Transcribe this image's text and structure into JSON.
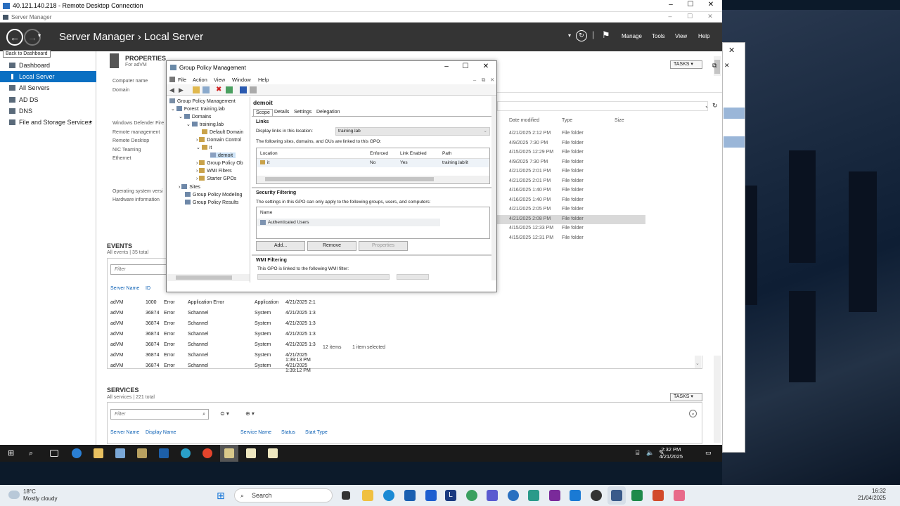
{
  "rdp": {
    "title": "40.121.140.218 - Remote Desktop Connection",
    "minimize": "–",
    "maximize": "☐",
    "close": "✕"
  },
  "server_manager": {
    "title": "Server Manager",
    "breadcrumb": "Server Manager  ›  Local Server",
    "menu": {
      "manage": "Manage",
      "tools": "Tools",
      "view": "View",
      "help": "Help"
    },
    "tooltip": "Back to Dashboard",
    "nav": [
      {
        "label": "Dashboard"
      },
      {
        "label": "Local Server"
      },
      {
        "label": "All Servers"
      },
      {
        "label": "AD DS"
      },
      {
        "label": "DNS"
      },
      {
        "label": "File and Storage Services"
      }
    ],
    "properties": {
      "title": "PROPERTIES",
      "subtitle": "For adVM",
      "tasks": "TASKS",
      "labels": [
        "Computer name",
        "Domain",
        "Windows Defender Fire",
        "Remote management",
        "Remote Desktop",
        "NIC Teaming",
        "Ethernet",
        "Operating system versi",
        "Hardware information"
      ]
    },
    "events": {
      "title": "EVENTS",
      "subtitle": "All events | 35 total",
      "filter_placeholder": "Filter",
      "columns": [
        "Server Name",
        "ID"
      ],
      "rows": [
        [
          "adVM",
          "1000",
          "Error",
          "Application Error",
          "Application",
          "4/21/2025 2:1"
        ],
        [
          "adVM",
          "36874",
          "Error",
          "Schannel",
          "System",
          "4/21/2025 1:3"
        ],
        [
          "adVM",
          "36874",
          "Error",
          "Schannel",
          "System",
          "4/21/2025 1:3"
        ],
        [
          "adVM",
          "36874",
          "Error",
          "Schannel",
          "System",
          "4/21/2025 1:3"
        ],
        [
          "adVM",
          "36874",
          "Error",
          "Schannel",
          "System",
          "4/21/2025 1:3"
        ],
        [
          "adVM",
          "36874",
          "Error",
          "Schannel",
          "System",
          "4/21/2025 1:39:13 PM"
        ],
        [
          "adVM",
          "36874",
          "Error",
          "Schannel",
          "System",
          "4/21/2025 1:39:12 PM"
        ]
      ]
    },
    "services": {
      "title": "SERVICES",
      "subtitle": "All services | 221 total",
      "filter_placeholder": "Filter",
      "tasks": "TASKS",
      "columns": [
        "Server Name",
        "Display Name",
        "Service Name",
        "Status",
        "Start Type"
      ]
    }
  },
  "explorer": {
    "columns": [
      "Date modified",
      "Type",
      "Size"
    ],
    "rows": [
      [
        "4/21/2025 2:12 PM",
        "File folder"
      ],
      [
        "4/9/2025 7:30 PM",
        "File folder"
      ],
      [
        "4/15/2025 12:29 PM",
        "File folder"
      ],
      [
        "4/9/2025 7:30 PM",
        "File folder"
      ],
      [
        "4/21/2025 2:01 PM",
        "File folder"
      ],
      [
        "4/21/2025 2:01 PM",
        "File folder"
      ],
      [
        "4/16/2025 1:40 PM",
        "File folder"
      ],
      [
        "4/16/2025 1:40 PM",
        "File folder"
      ],
      [
        "4/21/2025 2:05 PM",
        "File folder"
      ],
      [
        "4/21/2025 2:08 PM",
        "File folder"
      ],
      [
        "4/15/2025 12:33 PM",
        "File folder"
      ],
      [
        "4/15/2025 12:31 PM",
        "File folder"
      ]
    ],
    "item_count": "12 items",
    "selected_count": "1 item selected"
  },
  "gpmc": {
    "title": "Group Policy Management",
    "menu": [
      "File",
      "Action",
      "View",
      "Window",
      "Help"
    ],
    "tree": [
      {
        "label": "Group Policy Management"
      },
      {
        "label": "Forest: training.lab"
      },
      {
        "label": "Domains"
      },
      {
        "label": "training.lab"
      },
      {
        "label": "Default Domain"
      },
      {
        "label": "Domain Control"
      },
      {
        "label": "it"
      },
      {
        "label": "demoit"
      },
      {
        "label": "Group Policy Ob"
      },
      {
        "label": "WMI Filters"
      },
      {
        "label": "Starter GPOs"
      },
      {
        "label": "Sites"
      },
      {
        "label": "Group Policy Modeling"
      },
      {
        "label": "Group Policy Results"
      }
    ],
    "gpo_name": "demoit",
    "tabs": [
      "Scope",
      "Details",
      "Settings",
      "Delegation"
    ],
    "links": {
      "heading": "Links",
      "display_label": "Display links in this location:",
      "location_value": "training.lab",
      "desc": "The following sites, domains, and OUs are linked to this GPO:",
      "columns": [
        "Location",
        "Enforced",
        "Link Enabled",
        "Path"
      ],
      "row": [
        "it",
        "No",
        "Yes",
        "training.lab/it"
      ]
    },
    "security": {
      "heading": "Security Filtering",
      "desc": "The settings in this GPO can only apply to the following groups, users, and computers:",
      "column": "Name",
      "entry": "Authenticated Users",
      "add": "Add...",
      "remove": "Remove",
      "properties": "Properties"
    },
    "wmi": {
      "heading": "WMI Filtering",
      "desc": "This GPO is linked to the following WMI filter:"
    }
  },
  "inner_taskbar": {
    "time": "2:32 PM",
    "date": "4/21/2025"
  },
  "host_taskbar": {
    "temp": "18°C",
    "weather": "Mostly cloudy",
    "search": "Search",
    "time": "16:32",
    "date": "21/04/2025"
  }
}
